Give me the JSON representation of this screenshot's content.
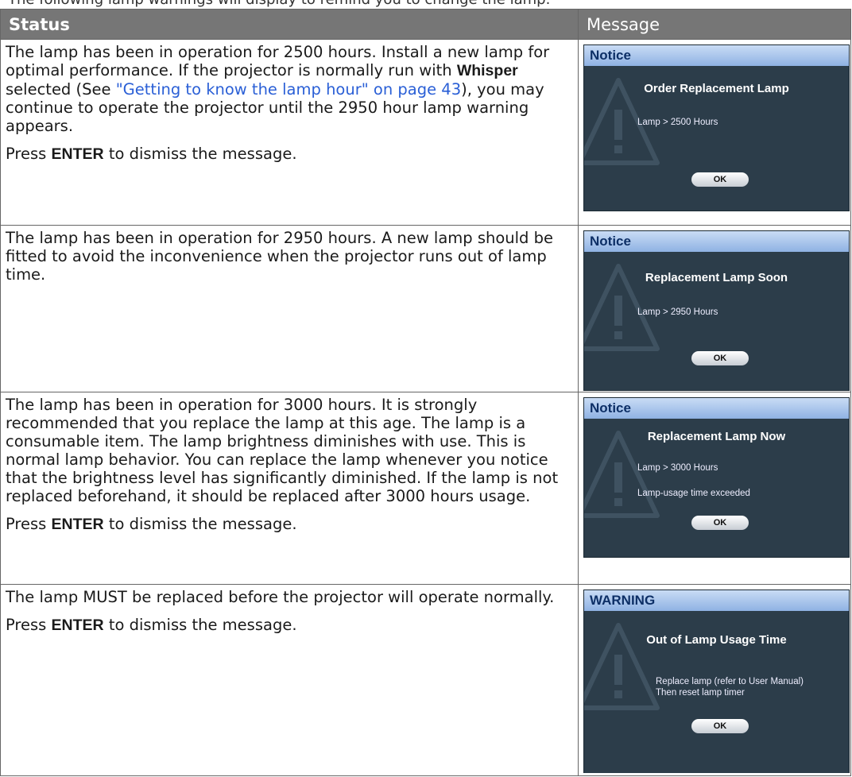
{
  "top_line": "The following lamp warnings will display to remind you to change the lamp.",
  "header": {
    "status": "Status",
    "message": "Message"
  },
  "rows": [
    {
      "status_parts": {
        "a": "The lamp has been in operation for 2500 hours. Install a new lamp for optimal performance. If the projector is normally run with ",
        "b": "Whisper",
        "c": " selected (See ",
        "link": "\"Getting to know the lamp hour\" on page 43",
        "d": "), you may continue to operate the projector until the 2950 hour lamp warning appears."
      },
      "press_prefix": "Press ",
      "press_key": "ENTER",
      "press_suffix": " to dismiss the message.",
      "osd": {
        "bar": "Notice",
        "title": "Order Replacement Lamp",
        "line1": "Lamp > 2500 Hours",
        "ok": "OK"
      }
    },
    {
      "status_text": "The lamp has been in operation for 2950 hours.  A new lamp should be fitted to avoid the  inconvenience when the projector runs out of  lamp time.",
      "osd": {
        "bar": "Notice",
        "title": "Replacement Lamp Soon",
        "line1": "Lamp > 2950 Hours",
        "ok": "OK"
      }
    },
    {
      "status_text": "The lamp has been in operation for 3000 hours. It is strongly recommended that you replace the lamp at this age. The lamp is a consumable item. The lamp brightness diminishes with use. This is normal lamp behavior. You can replace the lamp whenever you notice that the brightness level has significantly diminished. If the lamp is not replaced beforehand, it should be replaced after 3000 hours usage.",
      "press_prefix": "Press ",
      "press_key": "ENTER",
      "press_suffix": " to dismiss the message.",
      "osd": {
        "bar": "Notice",
        "title": "Replacement Lamp Now",
        "line1": "Lamp > 3000 Hours",
        "line2": "Lamp-usage time exceeded",
        "ok": "OK"
      }
    },
    {
      "status_text": "The lamp MUST be replaced before the projector will operate normally.",
      "press_prefix": "Press ",
      "press_key": "ENTER",
      "press_suffix": " to dismiss the message.",
      "osd": {
        "bar": "WARNING",
        "title": "Out of Lamp Usage Time",
        "line1": "Replace lamp (refer to User Manual)",
        "line2": "Then reset lamp timer",
        "ok": "OK"
      }
    }
  ],
  "colors": {
    "header_bg": "#767676",
    "link": "#2a5fd6",
    "osd_bg": "#2c3d4a",
    "osd_bar_text": "#0d2f66"
  }
}
